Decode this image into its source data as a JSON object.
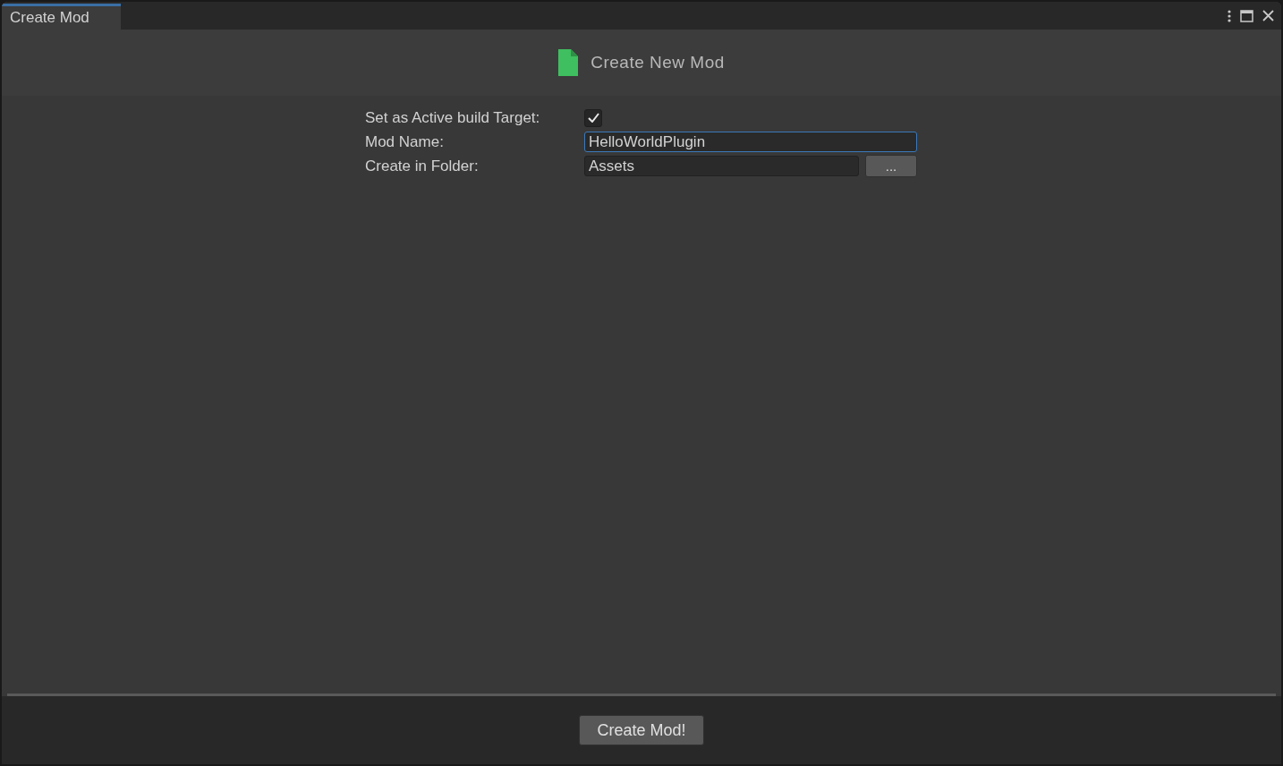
{
  "window": {
    "tab": {
      "label": "Create Mod",
      "selected": true
    }
  },
  "header": {
    "title": "Create New Mod"
  },
  "form": [
    {
      "kind": "checkbox",
      "label": "Set as Active build Target:",
      "checked": true
    },
    {
      "kind": "text",
      "label": "Mod Name:",
      "value": "HelloWorldPlugin",
      "focused": true
    },
    {
      "kind": "folder",
      "label": "Create in Folder:",
      "value": "Assets",
      "focused": false,
      "button": "..."
    }
  ],
  "footer": {
    "button": "Create Mod!"
  }
}
